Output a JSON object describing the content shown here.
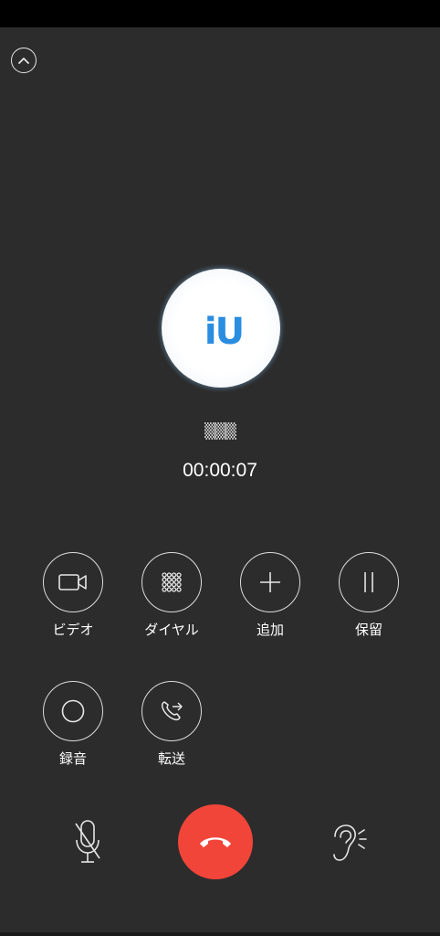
{
  "call": {
    "avatar_text": "iU",
    "caller_name": "▒▒▒",
    "timer": "00:00:07"
  },
  "actions": [
    {
      "label": "ビデオ",
      "icon": "video-camera-icon"
    },
    {
      "label": "ダイヤル",
      "icon": "dialpad-icon"
    },
    {
      "label": "追加",
      "icon": "plus-icon"
    },
    {
      "label": "保留",
      "icon": "pause-icon"
    },
    {
      "label": "録音",
      "icon": "record-icon"
    },
    {
      "label": "転送",
      "icon": "transfer-call-icon"
    }
  ],
  "bottom": {
    "mute_icon": "microphone-muted-icon",
    "end_icon": "end-call-icon",
    "speaker_icon": "ear-earpiece-icon"
  },
  "colors": {
    "background": "#2c2c2c",
    "end_call": "#f2453a",
    "avatar_accent": "#2a8de0"
  }
}
